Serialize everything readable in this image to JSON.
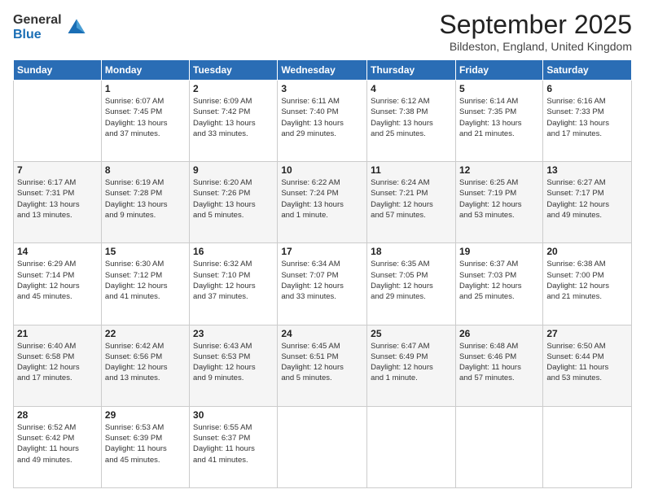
{
  "logo": {
    "general": "General",
    "blue": "Blue"
  },
  "header": {
    "month": "September 2025",
    "location": "Bildeston, England, United Kingdom"
  },
  "weekdays": [
    "Sunday",
    "Monday",
    "Tuesday",
    "Wednesday",
    "Thursday",
    "Friday",
    "Saturday"
  ],
  "weeks": [
    [
      {
        "day": "",
        "info": ""
      },
      {
        "day": "1",
        "info": "Sunrise: 6:07 AM\nSunset: 7:45 PM\nDaylight: 13 hours\nand 37 minutes."
      },
      {
        "day": "2",
        "info": "Sunrise: 6:09 AM\nSunset: 7:42 PM\nDaylight: 13 hours\nand 33 minutes."
      },
      {
        "day": "3",
        "info": "Sunrise: 6:11 AM\nSunset: 7:40 PM\nDaylight: 13 hours\nand 29 minutes."
      },
      {
        "day": "4",
        "info": "Sunrise: 6:12 AM\nSunset: 7:38 PM\nDaylight: 13 hours\nand 25 minutes."
      },
      {
        "day": "5",
        "info": "Sunrise: 6:14 AM\nSunset: 7:35 PM\nDaylight: 13 hours\nand 21 minutes."
      },
      {
        "day": "6",
        "info": "Sunrise: 6:16 AM\nSunset: 7:33 PM\nDaylight: 13 hours\nand 17 minutes."
      }
    ],
    [
      {
        "day": "7",
        "info": "Sunrise: 6:17 AM\nSunset: 7:31 PM\nDaylight: 13 hours\nand 13 minutes."
      },
      {
        "day": "8",
        "info": "Sunrise: 6:19 AM\nSunset: 7:28 PM\nDaylight: 13 hours\nand 9 minutes."
      },
      {
        "day": "9",
        "info": "Sunrise: 6:20 AM\nSunset: 7:26 PM\nDaylight: 13 hours\nand 5 minutes."
      },
      {
        "day": "10",
        "info": "Sunrise: 6:22 AM\nSunset: 7:24 PM\nDaylight: 13 hours\nand 1 minute."
      },
      {
        "day": "11",
        "info": "Sunrise: 6:24 AM\nSunset: 7:21 PM\nDaylight: 12 hours\nand 57 minutes."
      },
      {
        "day": "12",
        "info": "Sunrise: 6:25 AM\nSunset: 7:19 PM\nDaylight: 12 hours\nand 53 minutes."
      },
      {
        "day": "13",
        "info": "Sunrise: 6:27 AM\nSunset: 7:17 PM\nDaylight: 12 hours\nand 49 minutes."
      }
    ],
    [
      {
        "day": "14",
        "info": "Sunrise: 6:29 AM\nSunset: 7:14 PM\nDaylight: 12 hours\nand 45 minutes."
      },
      {
        "day": "15",
        "info": "Sunrise: 6:30 AM\nSunset: 7:12 PM\nDaylight: 12 hours\nand 41 minutes."
      },
      {
        "day": "16",
        "info": "Sunrise: 6:32 AM\nSunset: 7:10 PM\nDaylight: 12 hours\nand 37 minutes."
      },
      {
        "day": "17",
        "info": "Sunrise: 6:34 AM\nSunset: 7:07 PM\nDaylight: 12 hours\nand 33 minutes."
      },
      {
        "day": "18",
        "info": "Sunrise: 6:35 AM\nSunset: 7:05 PM\nDaylight: 12 hours\nand 29 minutes."
      },
      {
        "day": "19",
        "info": "Sunrise: 6:37 AM\nSunset: 7:03 PM\nDaylight: 12 hours\nand 25 minutes."
      },
      {
        "day": "20",
        "info": "Sunrise: 6:38 AM\nSunset: 7:00 PM\nDaylight: 12 hours\nand 21 minutes."
      }
    ],
    [
      {
        "day": "21",
        "info": "Sunrise: 6:40 AM\nSunset: 6:58 PM\nDaylight: 12 hours\nand 17 minutes."
      },
      {
        "day": "22",
        "info": "Sunrise: 6:42 AM\nSunset: 6:56 PM\nDaylight: 12 hours\nand 13 minutes."
      },
      {
        "day": "23",
        "info": "Sunrise: 6:43 AM\nSunset: 6:53 PM\nDaylight: 12 hours\nand 9 minutes."
      },
      {
        "day": "24",
        "info": "Sunrise: 6:45 AM\nSunset: 6:51 PM\nDaylight: 12 hours\nand 5 minutes."
      },
      {
        "day": "25",
        "info": "Sunrise: 6:47 AM\nSunset: 6:49 PM\nDaylight: 12 hours\nand 1 minute."
      },
      {
        "day": "26",
        "info": "Sunrise: 6:48 AM\nSunset: 6:46 PM\nDaylight: 11 hours\nand 57 minutes."
      },
      {
        "day": "27",
        "info": "Sunrise: 6:50 AM\nSunset: 6:44 PM\nDaylight: 11 hours\nand 53 minutes."
      }
    ],
    [
      {
        "day": "28",
        "info": "Sunrise: 6:52 AM\nSunset: 6:42 PM\nDaylight: 11 hours\nand 49 minutes."
      },
      {
        "day": "29",
        "info": "Sunrise: 6:53 AM\nSunset: 6:39 PM\nDaylight: 11 hours\nand 45 minutes."
      },
      {
        "day": "30",
        "info": "Sunrise: 6:55 AM\nSunset: 6:37 PM\nDaylight: 11 hours\nand 41 minutes."
      },
      {
        "day": "",
        "info": ""
      },
      {
        "day": "",
        "info": ""
      },
      {
        "day": "",
        "info": ""
      },
      {
        "day": "",
        "info": ""
      }
    ]
  ]
}
